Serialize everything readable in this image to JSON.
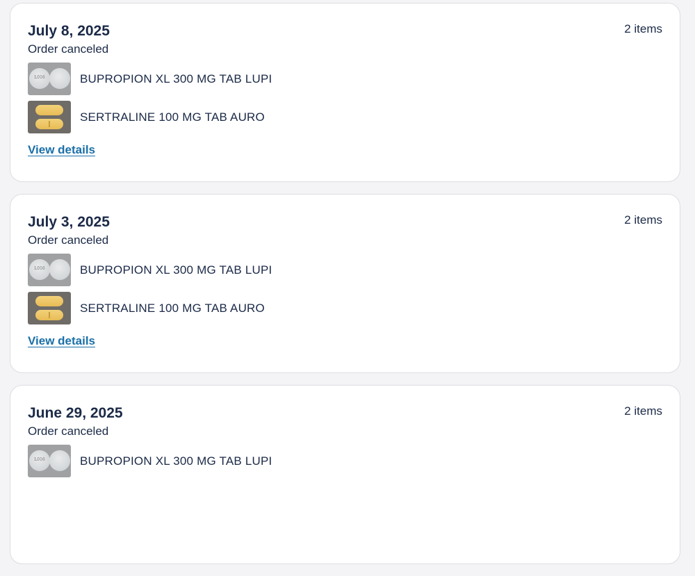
{
  "orders": [
    {
      "date": "July 8, 2025",
      "status": "Order canceled",
      "count": "2 items",
      "items": [
        {
          "name": "BUPROPION XL 300 MG TAB LUPI",
          "pill_imprint": "L016"
        },
        {
          "name": "SERTRALINE 100 MG TAB AURO"
        }
      ],
      "link": "View details"
    },
    {
      "date": "July 3, 2025",
      "status": "Order canceled",
      "count": "2 items",
      "items": [
        {
          "name": "BUPROPION XL 300 MG TAB LUPI",
          "pill_imprint": "L016"
        },
        {
          "name": "SERTRALINE 100 MG TAB AURO"
        }
      ],
      "link": "View details"
    },
    {
      "date": "June 29, 2025",
      "status": "Order canceled",
      "count": "2 items",
      "items": [
        {
          "name": "BUPROPION XL 300 MG TAB LUPI",
          "pill_imprint": "L016"
        }
      ]
    }
  ],
  "colors": {
    "text": "#1b2a47",
    "link": "#1a6fa8",
    "card_border": "#dcdde3",
    "page_bg": "#f4f4f6"
  }
}
